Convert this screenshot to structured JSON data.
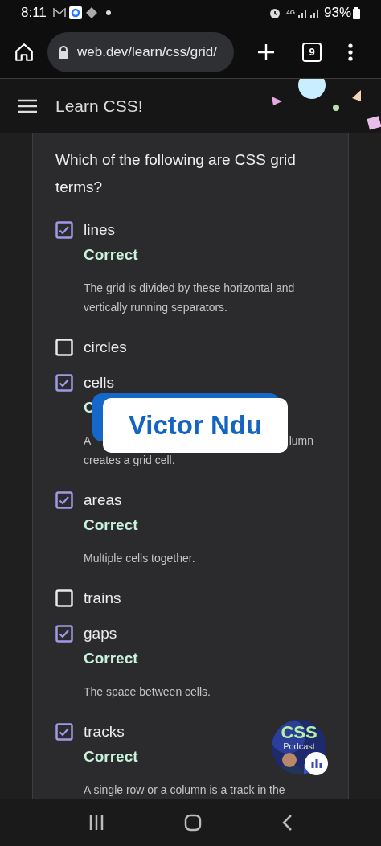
{
  "status_bar": {
    "time": "8:11",
    "network": "4G",
    "battery": "93%"
  },
  "browser": {
    "url": "web.dev/learn/css/grid/",
    "tab_count": "9"
  },
  "header": {
    "title": "Learn CSS!"
  },
  "quiz": {
    "question": "Which of the following are CSS grid terms?",
    "options": [
      {
        "label": "lines",
        "checked": true,
        "feedback": "Correct",
        "explanation": [
          "The grid is divided by these horizontal and",
          "vertically running separators."
        ]
      },
      {
        "label": "circles",
        "checked": false
      },
      {
        "label": "cells",
        "checked": true,
        "feedback": "C",
        "explanation_split": {
          "left": "A",
          "right": "lumn"
        },
        "explanation": [
          "creates a grid cell."
        ]
      },
      {
        "label": "areas",
        "checked": true,
        "feedback": "Correct",
        "explanation": [
          "Multiple cells together."
        ]
      },
      {
        "label": "trains",
        "checked": false
      },
      {
        "label": "gaps",
        "checked": true,
        "feedback": "Correct",
        "explanation": [
          "The space between cells."
        ]
      },
      {
        "label": "tracks",
        "checked": true,
        "feedback": "Correct",
        "explanation": [
          "A single row or a column is a track in the"
        ]
      }
    ]
  },
  "caption": {
    "name": "Victor Ndu"
  },
  "podcast_bubble": {
    "title": "CSS",
    "subtitle": "Podcast"
  }
}
